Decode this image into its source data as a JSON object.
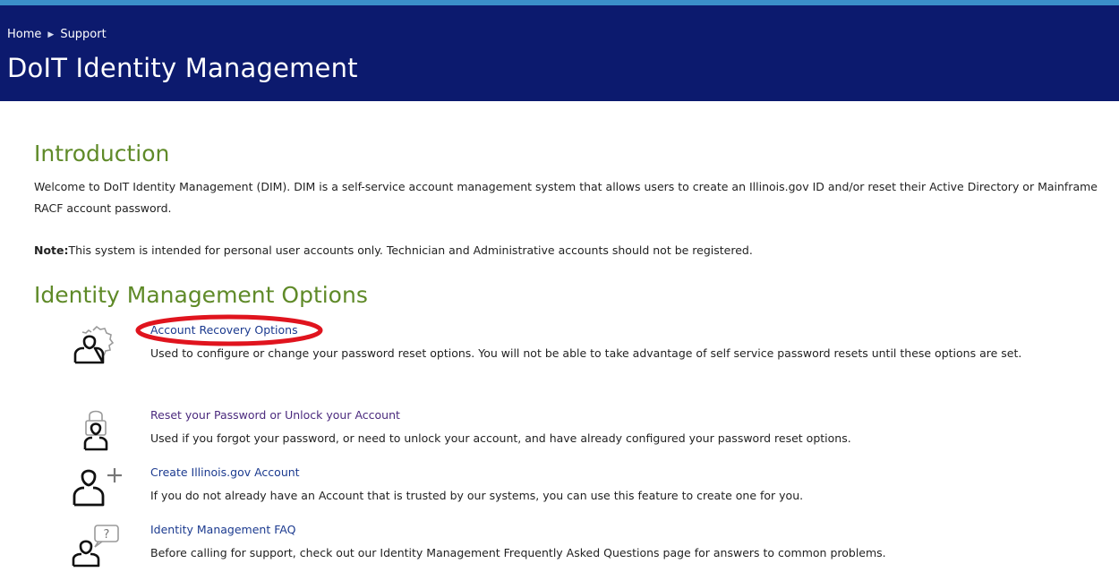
{
  "header": {
    "breadcrumb": [
      "Home",
      "Support"
    ],
    "title": "DoIT Identity Management"
  },
  "intro": {
    "title": "Introduction",
    "paragraph": "Welcome to DoIT Identity Management (DIM). DIM is a self-service account management system that allows users to create an Illinois.gov ID and/or reset their Active Directory or Mainframe RACF account password.",
    "note_label": "Note:",
    "note_text": "This system is intended for personal user accounts only. Technician and Administrative accounts should not be registered."
  },
  "options": {
    "title": "Identity Management Options",
    "items": [
      {
        "label": "Account Recovery Options",
        "description": "Used to configure or change your password reset options. You will not be able to take advantage of self service password resets until these options are set.",
        "icon": "user-gear-icon"
      },
      {
        "label": "Reset your Password or Unlock your Account",
        "description": "Used if you forgot your password, or need to unlock your account, and have already configured your password reset options.",
        "icon": "user-lock-icon"
      },
      {
        "label": "Create Illinois.gov Account",
        "description": "If you do not already have an Account that is trusted by our systems, you can use this feature to create one for you.",
        "icon": "user-add-icon"
      },
      {
        "label": "Identity Management FAQ",
        "description": "Before calling for support, check out our Identity Management Frequently Asked Questions page for answers to common problems.",
        "icon": "user-question-icon"
      }
    ]
  },
  "colors": {
    "header_bg": "#0c1a6e",
    "header_top_border": "#3b8fc9",
    "section_title": "#5f8a28",
    "link": "#1b3a8f",
    "highlight": "#e0141e"
  }
}
